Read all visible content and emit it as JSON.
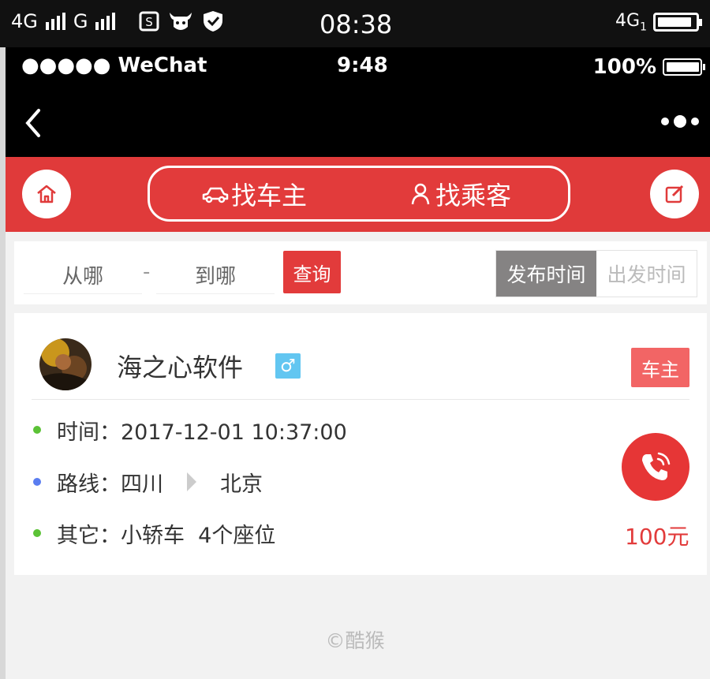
{
  "phone_status": {
    "left_text_1": "4G",
    "left_text_2": "G",
    "time": "08:38",
    "right_text": "4G",
    "right_sub": "1"
  },
  "wechat_status": {
    "carrier": "●●●●● WeChat",
    "time": "9:48",
    "battery": "100%"
  },
  "tabs": {
    "driver": "找车主",
    "passenger": "找乘客"
  },
  "search": {
    "from_placeholder": "从哪",
    "dash": "-",
    "to_placeholder": "到哪",
    "query_label": "查询",
    "sort_publish": "发布时间",
    "sort_depart": "出发时间"
  },
  "listing": {
    "username": "海之心软件",
    "gender_symbol": "♂",
    "role": "车主",
    "time_label": "时间：2017-12-01 10:37:00",
    "route_label": "路线：四川",
    "route_to": "北京",
    "other_label": "其它：小轿车  4个座位",
    "price": "100元"
  },
  "footer": "©酷猴",
  "colors": {
    "accent_red": "#e03a3a",
    "dot_green": "#5bc236",
    "dot_blue": "#5a7df0",
    "gender_blue": "#62c6f1",
    "role_red": "#f26565"
  },
  "icons": {
    "home": "home-icon",
    "edit": "edit-icon",
    "car": "car-icon",
    "person": "person-icon",
    "phone": "phone-icon",
    "back": "back-icon",
    "more": "more-icon"
  }
}
